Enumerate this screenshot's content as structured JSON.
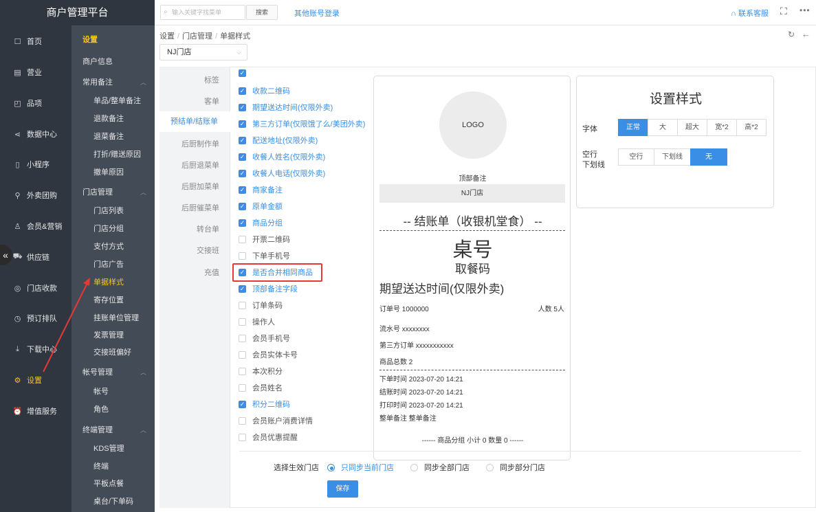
{
  "app": {
    "title": "商户管理平台"
  },
  "nav": [
    {
      "label": "首页",
      "icon": "square-icon"
    },
    {
      "label": "营业",
      "icon": "calendar-icon"
    },
    {
      "label": "品项",
      "icon": "bag-icon"
    },
    {
      "label": "数据中心",
      "icon": "share-icon"
    },
    {
      "label": "小程序",
      "icon": "phone-icon"
    },
    {
      "label": "外卖团购",
      "icon": "bike-icon"
    },
    {
      "label": "会员&营销",
      "icon": "user-icon"
    },
    {
      "label": "供应链",
      "icon": "truck-icon"
    },
    {
      "label": "门店收款",
      "icon": "coins-icon"
    },
    {
      "label": "预订排队",
      "icon": "clock-icon"
    },
    {
      "label": "下载中心",
      "icon": "download-icon"
    },
    {
      "label": "设置",
      "icon": "gear-icon"
    },
    {
      "label": "增值服务",
      "icon": "alarm-icon"
    }
  ],
  "subnav": {
    "top": "设置",
    "merchant_info": "商户信息",
    "group1": "常用备注",
    "g1_items": [
      "单品/整单备注",
      "退款备注",
      "退菜备注",
      "打折/赠送原因",
      "撤单原因"
    ],
    "group2": "门店管理",
    "g2_items": [
      "门店列表",
      "门店分组",
      "支付方式",
      "门店广告",
      "单据样式",
      "寄存位置",
      "挂账单位管理",
      "发票管理",
      "交接班偏好"
    ],
    "group3": "帐号管理",
    "g3_items": [
      "帐号",
      "角色"
    ],
    "group4": "终端管理",
    "g4_items": [
      "KDS管理",
      "终端",
      "平板点餐",
      "桌台/下单码"
    ]
  },
  "topbar": {
    "search_placeholder": "输入关键字找菜单",
    "search_button": "搜索",
    "other_login": "其他账号登录",
    "contact": "联系客服"
  },
  "breadcrumb": [
    "设置",
    "门店管理",
    "单据样式"
  ],
  "store_select": {
    "value": "NJ门店"
  },
  "tabs": [
    "标签",
    "客单",
    "预结单/结账单",
    "后厨制作单",
    "后厨退菜单",
    "后厨加菜单",
    "后厨催菜单",
    "转台单",
    "交接班",
    "充值"
  ],
  "checkboxes": [
    {
      "label": "收款二维码",
      "checked": true
    },
    {
      "label": "期望送达时间(仅限外卖)",
      "checked": true
    },
    {
      "label": "第三方订单(仅限饿了么/美团外卖)",
      "checked": true
    },
    {
      "label": "配送地址(仅限外卖)",
      "checked": true
    },
    {
      "label": "收餐人姓名(仅限外卖)",
      "checked": true
    },
    {
      "label": "收餐人电话(仅限外卖)",
      "checked": true
    },
    {
      "label": "商家备注",
      "checked": true
    },
    {
      "label": "原单金额",
      "checked": true
    },
    {
      "label": "商品分组",
      "checked": true
    },
    {
      "label": "开票二维码",
      "checked": false
    },
    {
      "label": "下单手机号",
      "checked": false
    },
    {
      "label": "是否合并相同商品",
      "checked": true
    },
    {
      "label": "顶部备注字段",
      "checked": true
    },
    {
      "label": "订单条码",
      "checked": false
    },
    {
      "label": "操作人",
      "checked": false
    },
    {
      "label": "会员手机号",
      "checked": false
    },
    {
      "label": "会员实体卡号",
      "checked": false
    },
    {
      "label": "本次积分",
      "checked": false
    },
    {
      "label": "会员姓名",
      "checked": false
    },
    {
      "label": "积分二维码",
      "checked": true
    },
    {
      "label": "会员账户消费详情",
      "checked": false
    },
    {
      "label": "会员优惠提醒",
      "checked": false
    }
  ],
  "receipt": {
    "logo": "LOGO",
    "top_note": "顶部备注",
    "store": "NJ门店",
    "title": "-- 结账单（收银机堂食） --",
    "table": "桌号",
    "pickup": "取餐码",
    "expect": "期望送达时间(仅限外卖)",
    "order_no": "订单号 1000000",
    "guests": "人数 5人",
    "serial": "流水号 xxxxxxxx",
    "third": "第三方订单 xxxxxxxxxxx",
    "count": "商品总数 2",
    "order_time": "下单时间 2023-07-20 14:21",
    "checkout_time": "结账时间 2023-07-20 14:21",
    "print_time": "打印时间 2023-07-20 14:21",
    "remark": "整单备注 整单备注",
    "subtotal": "------ 商品分组 小计 0 数量 0 ------"
  },
  "style_panel": {
    "title": "设置样式",
    "font_label": "字体",
    "font_options": [
      "正常",
      "大",
      "超大",
      "宽*2",
      "高*2"
    ],
    "font_selected": 0,
    "gap_label_1": "空行",
    "gap_label_2": "下划线",
    "gap_options": [
      "空行",
      "下划线",
      "无"
    ],
    "gap_selected": 2
  },
  "scope": {
    "label": "选择生效门店",
    "options": [
      "只同步当前门店",
      "同步全部门店",
      "同步部分门店"
    ],
    "selected": 0
  },
  "save_button": "保存",
  "colors": {
    "accent": "#3a8ee6",
    "nav_active": "#f5c518",
    "highlight": "#e53935"
  }
}
